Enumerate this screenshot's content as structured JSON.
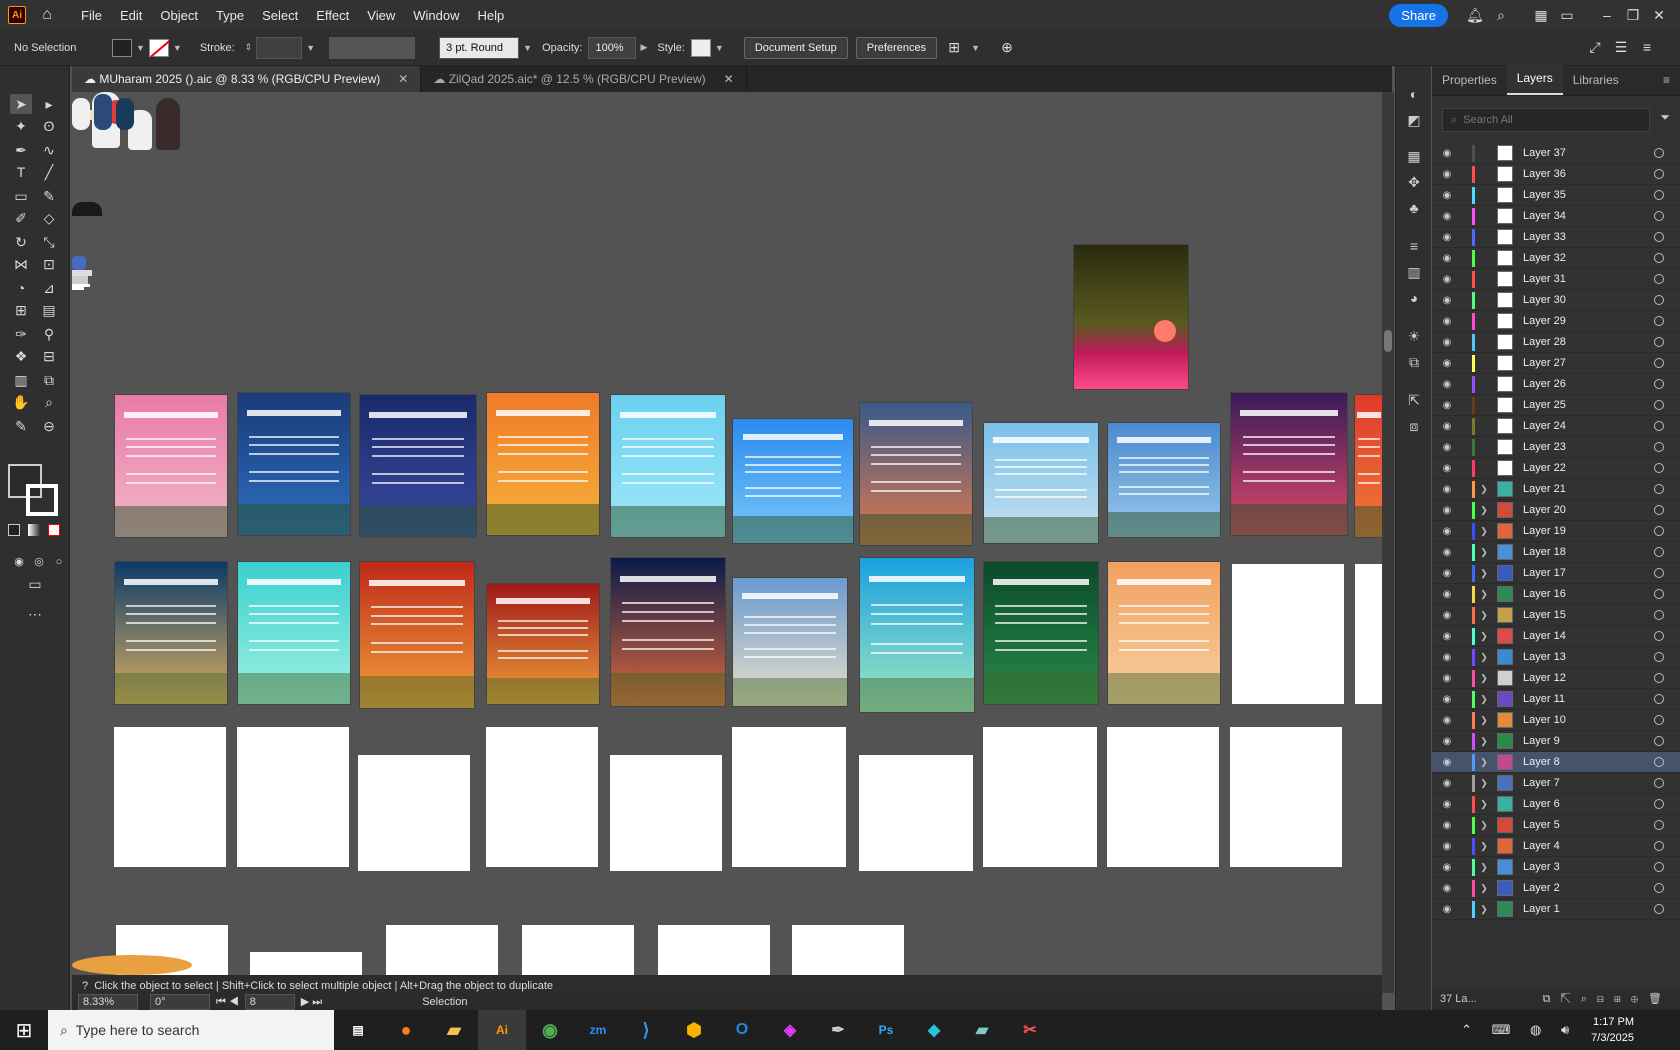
{
  "menubar": {
    "items": [
      "File",
      "Edit",
      "Object",
      "Type",
      "Select",
      "Effect",
      "View",
      "Window",
      "Help"
    ],
    "share": "Share"
  },
  "control": {
    "selection": "No Selection",
    "stroke_label": "Stroke:",
    "brush": "3 pt. Round",
    "opacity_label": "Opacity:",
    "opacity": "100%",
    "style_label": "Style:",
    "doc_setup": "Document Setup",
    "preferences": "Preferences"
  },
  "tabs": [
    {
      "label": "MUharam 2025 ().aic @ 8.33 % (RGB/CPU Preview)"
    },
    {
      "label": "ZilQad 2025.aic* @ 12.5 % (RGB/CPU Preview)"
    }
  ],
  "status": {
    "hint": "Click the object to select  |  Shift+Click to select multiple object  |  Alt+Drag the object to duplicate",
    "zoom": "8.33%",
    "rotate": "0°",
    "artboard": "8",
    "mode": "Selection"
  },
  "panel": {
    "tabs": [
      "Properties",
      "Layers",
      "Libraries"
    ],
    "search_placeholder": "Search All",
    "footer": "37 La...",
    "layers": [
      {
        "name": "Layer 37",
        "color": "#4f4f4f"
      },
      {
        "name": "Layer 36",
        "color": "#ff4d4d"
      },
      {
        "name": "Layer 35",
        "color": "#4ddcff"
      },
      {
        "name": "Layer 34",
        "color": "#ff4df0"
      },
      {
        "name": "Layer 33",
        "color": "#4d6bff"
      },
      {
        "name": "Layer 32",
        "color": "#4dff4d"
      },
      {
        "name": "Layer 31",
        "color": "#ff4d4d"
      },
      {
        "name": "Layer 30",
        "color": "#4dff7a"
      },
      {
        "name": "Layer 29",
        "color": "#ff4dd2"
      },
      {
        "name": "Layer 28",
        "color": "#4dc8ff"
      },
      {
        "name": "Layer 27",
        "color": "#ffff4d"
      },
      {
        "name": "Layer 26",
        "color": "#9b4dff"
      },
      {
        "name": "Layer 25",
        "color": "#6b3a1a"
      },
      {
        "name": "Layer 24",
        "color": "#7a7a2a"
      },
      {
        "name": "Layer 23",
        "color": "#3a7a3a"
      },
      {
        "name": "Layer 22",
        "color": "#ff3a6b"
      },
      {
        "name": "Layer 21",
        "color": "#ff9a3a"
      },
      {
        "name": "Layer 20",
        "color": "#4dff4d"
      },
      {
        "name": "Layer 19",
        "color": "#3a4dff"
      },
      {
        "name": "Layer 18",
        "color": "#4dffb0"
      },
      {
        "name": "Layer 17",
        "color": "#3a6bff"
      },
      {
        "name": "Layer 16",
        "color": "#ffd24d"
      },
      {
        "name": "Layer 15",
        "color": "#ff6b4d"
      },
      {
        "name": "Layer 14",
        "color": "#4dffd2"
      },
      {
        "name": "Layer 13",
        "color": "#6b4dff"
      },
      {
        "name": "Layer 12",
        "color": "#ff4da0"
      },
      {
        "name": "Layer 11",
        "color": "#4dff6b"
      },
      {
        "name": "Layer 10",
        "color": "#ff7a4d"
      },
      {
        "name": "Layer 9",
        "color": "#d24dff"
      },
      {
        "name": "Layer 8",
        "color": "#4d9bff",
        "selected": true
      },
      {
        "name": "Layer 7",
        "color": "#a0a0a0"
      },
      {
        "name": "Layer 6",
        "color": "#ff4d4d"
      },
      {
        "name": "Layer 5",
        "color": "#4dff4d"
      },
      {
        "name": "Layer 4",
        "color": "#4d4dff"
      },
      {
        "name": "Layer 3",
        "color": "#4dff9b"
      },
      {
        "name": "Layer 2",
        "color": "#ff4d9b"
      },
      {
        "name": "Layer 1",
        "color": "#4dd2ff"
      }
    ]
  },
  "taskbar": {
    "search": "Type here to search",
    "time": "1:17 PM",
    "date": "7/3/2025"
  }
}
